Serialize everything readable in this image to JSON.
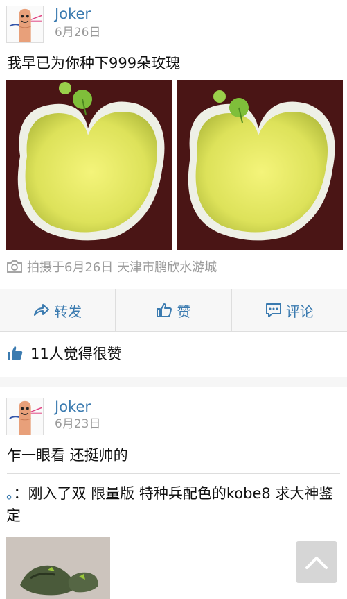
{
  "posts": [
    {
      "author": "Joker",
      "date": "6月26日",
      "text": "我早已为你种下999朵玫瑰",
      "photo_location": "拍摄于6月26日 天津市鹏欣水游城",
      "actions": {
        "forward": "转发",
        "like": "赞",
        "comment": "评论"
      },
      "likes_summary": "11人觉得很赞"
    },
    {
      "author": "Joker",
      "date": "6月23日",
      "text": "乍一眼看 还挺帅的",
      "repost_prefix": "。",
      "repost_text": "：刚入了双 限量版 特种兵配色的kobe8 求大神鉴定"
    }
  ],
  "colors": {
    "link_blue": "#3b7bb0",
    "muted_gray": "#9a9a9a",
    "background": "#f6f6f6"
  },
  "icons": [
    "forward-icon",
    "thumbs-up-icon",
    "comment-icon",
    "camera-icon",
    "chevron-up-icon"
  ]
}
